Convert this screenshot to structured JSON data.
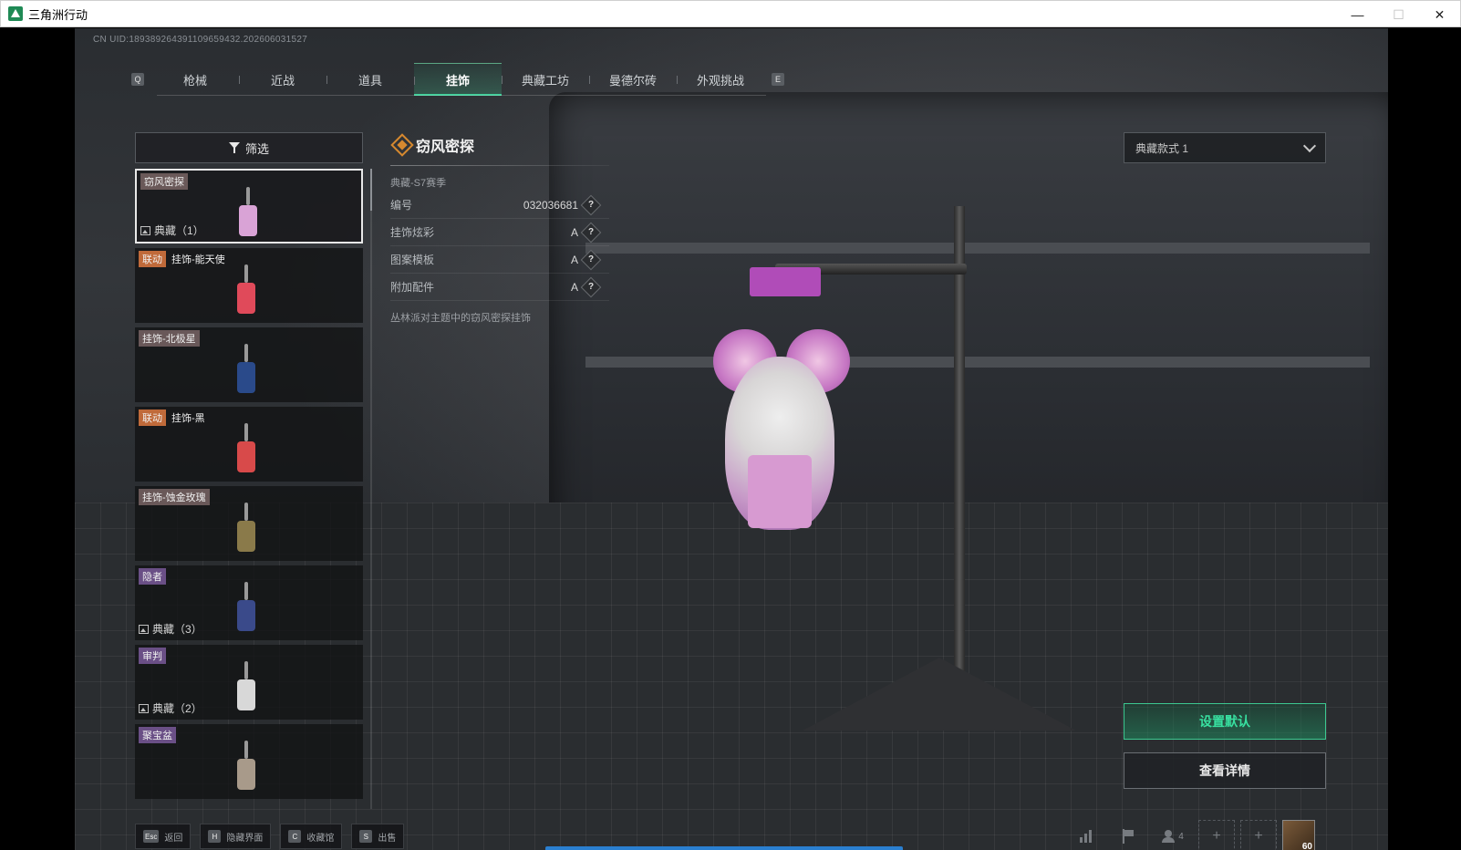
{
  "window": {
    "title": "三角洲行动",
    "controls": {
      "minimize": "—",
      "maximize": "☐",
      "close": "✕"
    }
  },
  "uid": "CN UID:18938926439110965943​2.202606031527",
  "tabs": {
    "prev_key": "Q",
    "next_key": "E",
    "items": [
      {
        "label": "枪械",
        "active": false
      },
      {
        "label": "近战",
        "active": false
      },
      {
        "label": "道具",
        "active": false
      },
      {
        "label": "挂饰",
        "active": true
      },
      {
        "label": "典藏工坊",
        "active": false
      },
      {
        "label": "曼德尔砖",
        "active": false
      },
      {
        "label": "外观挑战",
        "active": false
      }
    ]
  },
  "filter": {
    "label": "筛选"
  },
  "items": [
    {
      "tags": [
        {
          "text": "窃风密探",
          "style": "name"
        }
      ],
      "collection": "典藏（1）",
      "selected": true,
      "color": "#d9a3d6"
    },
    {
      "tags": [
        {
          "text": "联动",
          "style": "collab"
        },
        {
          "text": "挂饰-能天使",
          "style": "plain"
        }
      ],
      "collection": "",
      "selected": false,
      "color": "#e04a5a"
    },
    {
      "tags": [
        {
          "text": "挂饰-北极星",
          "style": "name"
        }
      ],
      "collection": "",
      "selected": false,
      "color": "#2a4a8a"
    },
    {
      "tags": [
        {
          "text": "联动",
          "style": "collab"
        },
        {
          "text": "挂饰-黑",
          "style": "plain"
        }
      ],
      "collection": "",
      "selected": false,
      "color": "#d84a4a"
    },
    {
      "tags": [
        {
          "text": "挂饰-蚀金玫瑰",
          "style": "name"
        }
      ],
      "collection": "",
      "selected": false,
      "color": "#8a7a4a"
    },
    {
      "tags": [
        {
          "text": "隐者",
          "style": "purple"
        }
      ],
      "collection": "典藏（3）",
      "selected": false,
      "color": "#3a4a8a"
    },
    {
      "tags": [
        {
          "text": "审判",
          "style": "purple"
        }
      ],
      "collection": "典藏（2）",
      "selected": false,
      "color": "#d8d8d8"
    },
    {
      "tags": [
        {
          "text": "聚宝盆",
          "style": "purple"
        }
      ],
      "collection": "",
      "selected": false,
      "color": "#a89a8a"
    }
  ],
  "detail": {
    "title": "窃风密探",
    "season": "典藏-S7赛季",
    "attributes": [
      {
        "label": "编号",
        "value": "032036681"
      },
      {
        "label": "挂饰炫彩",
        "value": "A"
      },
      {
        "label": "图案模板",
        "value": "A"
      },
      {
        "label": "附加配件",
        "value": "A"
      }
    ],
    "help_glyph": "?",
    "description": "丛林派对主题中的窃风密探挂饰"
  },
  "style_select": {
    "value": "典藏款式 1"
  },
  "actions": {
    "set_default": "设置默认",
    "view_details": "查看详情"
  },
  "bottom_hints": [
    {
      "key": "Esc",
      "label": "返回"
    },
    {
      "key": "H",
      "label": "隐藏界面"
    },
    {
      "key": "C",
      "label": "收藏馆"
    },
    {
      "key": "S",
      "label": "出售"
    }
  ],
  "bottom_right": {
    "team_count": "4",
    "plus": "+",
    "level": "60"
  },
  "colors": {
    "accent": "#3fd09a",
    "collab_tag": "#c06a3a",
    "rarity_purple": "#6a4f86",
    "title_diamond": "#d6892f"
  }
}
